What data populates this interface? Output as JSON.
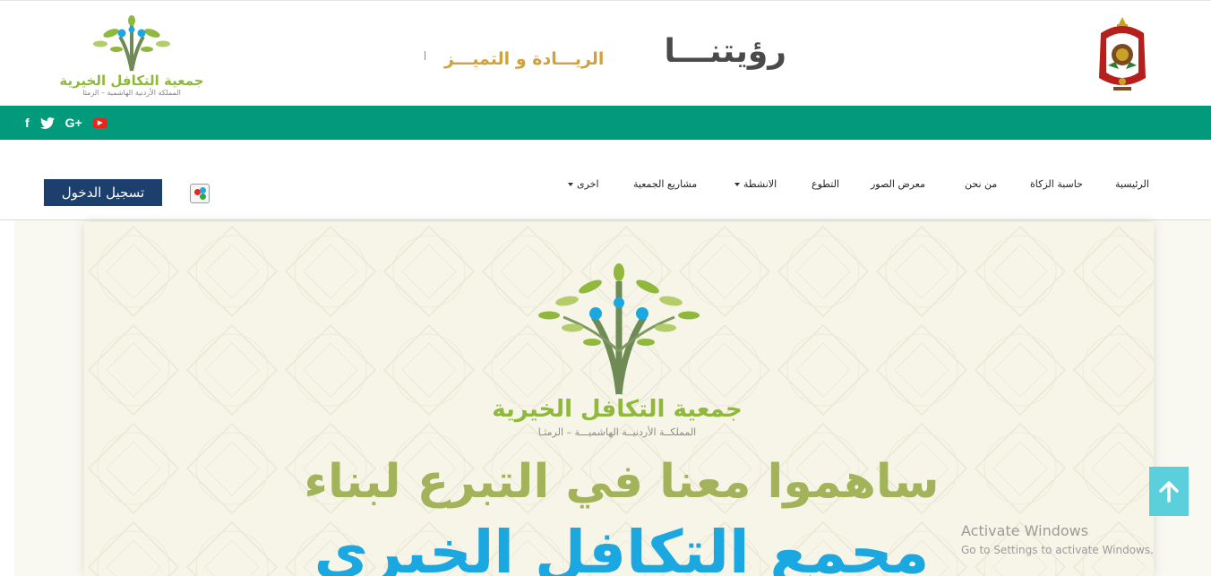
{
  "header": {
    "logo": {
      "name": "جمعية التكافل الخيرية",
      "subtitle": "المملكة الأردنية الهاشمية – الرمثا"
    },
    "vision": {
      "title": "رؤيتنـــا",
      "slogan": "الريـــادة و التميـــز"
    },
    "emblem_icon": "jordan-coat-of-arms-icon"
  },
  "social": {
    "icons": [
      "facebook-icon",
      "twitter-icon",
      "google-plus-icon",
      "youtube-icon"
    ],
    "facebook": "f",
    "twitter": "t",
    "google_plus": "G+",
    "youtube": "▶"
  },
  "nav": {
    "login_label": "تسجيل الدخول",
    "items": [
      {
        "label": "الرئيسية"
      },
      {
        "label": "حاسبة الزكاة"
      },
      {
        "label": "من نحن"
      },
      {
        "label": "معرض الصور"
      },
      {
        "label": "التطوع"
      },
      {
        "label": "الانشطة"
      },
      {
        "label": "مشاريع الجمعية"
      },
      {
        "label": "اخرى"
      }
    ]
  },
  "banner": {
    "logo_name": "جمعية التكافل الخيرية",
    "logo_subtitle": "المملكــة الأردنيــة الهاشميـــة – الرمثـا",
    "headline": "ساهموا معنا في التبرع لبناء",
    "headline2": "مجمع التكافل الخيري"
  },
  "scroll_top_icon": "arrow-up-icon",
  "watermark": {
    "title": "Activate Windows",
    "subtitle": "Go to Settings to activate Windows."
  },
  "colors": {
    "green_bar": "#019b7c",
    "login_button": "#1c3f6e",
    "logo_green": "#8fb83d",
    "headline_olive": "#a2b35a",
    "headline_blue": "#1ba8e1",
    "scroll_top": "#5bcfdc"
  }
}
